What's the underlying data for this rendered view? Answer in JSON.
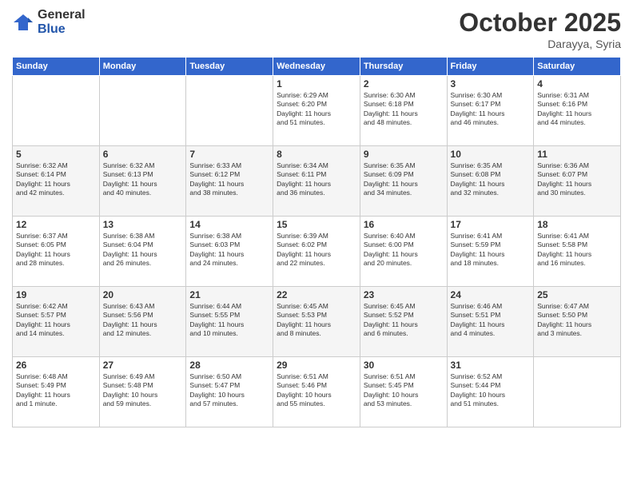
{
  "logo": {
    "general": "General",
    "blue": "Blue"
  },
  "header": {
    "month": "October 2025",
    "location": "Darayya, Syria"
  },
  "weekdays": [
    "Sunday",
    "Monday",
    "Tuesday",
    "Wednesday",
    "Thursday",
    "Friday",
    "Saturday"
  ],
  "weeks": [
    [
      {
        "day": "",
        "info": ""
      },
      {
        "day": "",
        "info": ""
      },
      {
        "day": "",
        "info": ""
      },
      {
        "day": "1",
        "info": "Sunrise: 6:29 AM\nSunset: 6:20 PM\nDaylight: 11 hours\nand 51 minutes."
      },
      {
        "day": "2",
        "info": "Sunrise: 6:30 AM\nSunset: 6:18 PM\nDaylight: 11 hours\nand 48 minutes."
      },
      {
        "day": "3",
        "info": "Sunrise: 6:30 AM\nSunset: 6:17 PM\nDaylight: 11 hours\nand 46 minutes."
      },
      {
        "day": "4",
        "info": "Sunrise: 6:31 AM\nSunset: 6:16 PM\nDaylight: 11 hours\nand 44 minutes."
      }
    ],
    [
      {
        "day": "5",
        "info": "Sunrise: 6:32 AM\nSunset: 6:14 PM\nDaylight: 11 hours\nand 42 minutes."
      },
      {
        "day": "6",
        "info": "Sunrise: 6:32 AM\nSunset: 6:13 PM\nDaylight: 11 hours\nand 40 minutes."
      },
      {
        "day": "7",
        "info": "Sunrise: 6:33 AM\nSunset: 6:12 PM\nDaylight: 11 hours\nand 38 minutes."
      },
      {
        "day": "8",
        "info": "Sunrise: 6:34 AM\nSunset: 6:11 PM\nDaylight: 11 hours\nand 36 minutes."
      },
      {
        "day": "9",
        "info": "Sunrise: 6:35 AM\nSunset: 6:09 PM\nDaylight: 11 hours\nand 34 minutes."
      },
      {
        "day": "10",
        "info": "Sunrise: 6:35 AM\nSunset: 6:08 PM\nDaylight: 11 hours\nand 32 minutes."
      },
      {
        "day": "11",
        "info": "Sunrise: 6:36 AM\nSunset: 6:07 PM\nDaylight: 11 hours\nand 30 minutes."
      }
    ],
    [
      {
        "day": "12",
        "info": "Sunrise: 6:37 AM\nSunset: 6:05 PM\nDaylight: 11 hours\nand 28 minutes."
      },
      {
        "day": "13",
        "info": "Sunrise: 6:38 AM\nSunset: 6:04 PM\nDaylight: 11 hours\nand 26 minutes."
      },
      {
        "day": "14",
        "info": "Sunrise: 6:38 AM\nSunset: 6:03 PM\nDaylight: 11 hours\nand 24 minutes."
      },
      {
        "day": "15",
        "info": "Sunrise: 6:39 AM\nSunset: 6:02 PM\nDaylight: 11 hours\nand 22 minutes."
      },
      {
        "day": "16",
        "info": "Sunrise: 6:40 AM\nSunset: 6:00 PM\nDaylight: 11 hours\nand 20 minutes."
      },
      {
        "day": "17",
        "info": "Sunrise: 6:41 AM\nSunset: 5:59 PM\nDaylight: 11 hours\nand 18 minutes."
      },
      {
        "day": "18",
        "info": "Sunrise: 6:41 AM\nSunset: 5:58 PM\nDaylight: 11 hours\nand 16 minutes."
      }
    ],
    [
      {
        "day": "19",
        "info": "Sunrise: 6:42 AM\nSunset: 5:57 PM\nDaylight: 11 hours\nand 14 minutes."
      },
      {
        "day": "20",
        "info": "Sunrise: 6:43 AM\nSunset: 5:56 PM\nDaylight: 11 hours\nand 12 minutes."
      },
      {
        "day": "21",
        "info": "Sunrise: 6:44 AM\nSunset: 5:55 PM\nDaylight: 11 hours\nand 10 minutes."
      },
      {
        "day": "22",
        "info": "Sunrise: 6:45 AM\nSunset: 5:53 PM\nDaylight: 11 hours\nand 8 minutes."
      },
      {
        "day": "23",
        "info": "Sunrise: 6:45 AM\nSunset: 5:52 PM\nDaylight: 11 hours\nand 6 minutes."
      },
      {
        "day": "24",
        "info": "Sunrise: 6:46 AM\nSunset: 5:51 PM\nDaylight: 11 hours\nand 4 minutes."
      },
      {
        "day": "25",
        "info": "Sunrise: 6:47 AM\nSunset: 5:50 PM\nDaylight: 11 hours\nand 3 minutes."
      }
    ],
    [
      {
        "day": "26",
        "info": "Sunrise: 6:48 AM\nSunset: 5:49 PM\nDaylight: 11 hours\nand 1 minute."
      },
      {
        "day": "27",
        "info": "Sunrise: 6:49 AM\nSunset: 5:48 PM\nDaylight: 10 hours\nand 59 minutes."
      },
      {
        "day": "28",
        "info": "Sunrise: 6:50 AM\nSunset: 5:47 PM\nDaylight: 10 hours\nand 57 minutes."
      },
      {
        "day": "29",
        "info": "Sunrise: 6:51 AM\nSunset: 5:46 PM\nDaylight: 10 hours\nand 55 minutes."
      },
      {
        "day": "30",
        "info": "Sunrise: 6:51 AM\nSunset: 5:45 PM\nDaylight: 10 hours\nand 53 minutes."
      },
      {
        "day": "31",
        "info": "Sunrise: 6:52 AM\nSunset: 5:44 PM\nDaylight: 10 hours\nand 51 minutes."
      },
      {
        "day": "",
        "info": ""
      }
    ]
  ]
}
